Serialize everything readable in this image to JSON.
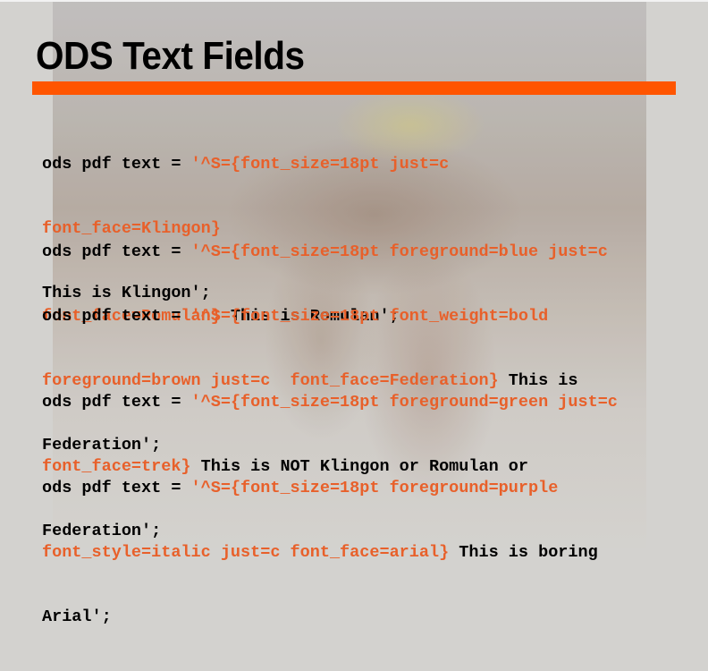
{
  "slide": {
    "title": "ODS Text Fields",
    "accent_color": "#ff5500",
    "option_text_color": "#e8602a",
    "examples": [
      {
        "lines": [
          {
            "prefix": "ods pdf text = ",
            "option": "'^S={font_size=18pt just=c",
            "suffix": ""
          },
          {
            "prefix": "",
            "option": "font_face=Klingon}",
            "suffix": ""
          },
          {
            "prefix": "This is Klingon';",
            "option": "",
            "suffix": ""
          }
        ]
      },
      {
        "lines": [
          {
            "prefix": "ods pdf text = ",
            "option": "'^S={font_size=18pt foreground=blue just=c",
            "suffix": ""
          },
          {
            "prefix": "",
            "option": "font_face=Romulan}",
            "suffix": " This is Romulan';"
          }
        ]
      },
      {
        "lines": [
          {
            "prefix": "ods pdf text = ",
            "option": "'^S={font_size=18pt font_weight=bold",
            "suffix": ""
          },
          {
            "prefix": "",
            "option": "foreground=brown just=c  font_face=Federation}",
            "suffix": " This is"
          },
          {
            "prefix": "Federation';",
            "option": "",
            "suffix": ""
          }
        ]
      },
      {
        "lines": [
          {
            "prefix": "ods pdf text = ",
            "option": "'^S={font_size=18pt foreground=green just=c",
            "suffix": ""
          },
          {
            "prefix": "",
            "option": "font_face=trek}",
            "suffix": " This is NOT Klingon or Romulan or"
          },
          {
            "prefix": "Federation';",
            "option": "",
            "suffix": ""
          }
        ]
      },
      {
        "lines": [
          {
            "prefix": "ods pdf text = ",
            "option": "'^S={font_size=18pt foreground=purple",
            "suffix": ""
          },
          {
            "prefix": "",
            "option": "font_style=italic just=c font_face=arial}",
            "suffix": " This is boring"
          },
          {
            "prefix": "Arial';",
            "option": "",
            "suffix": ""
          }
        ]
      }
    ]
  }
}
